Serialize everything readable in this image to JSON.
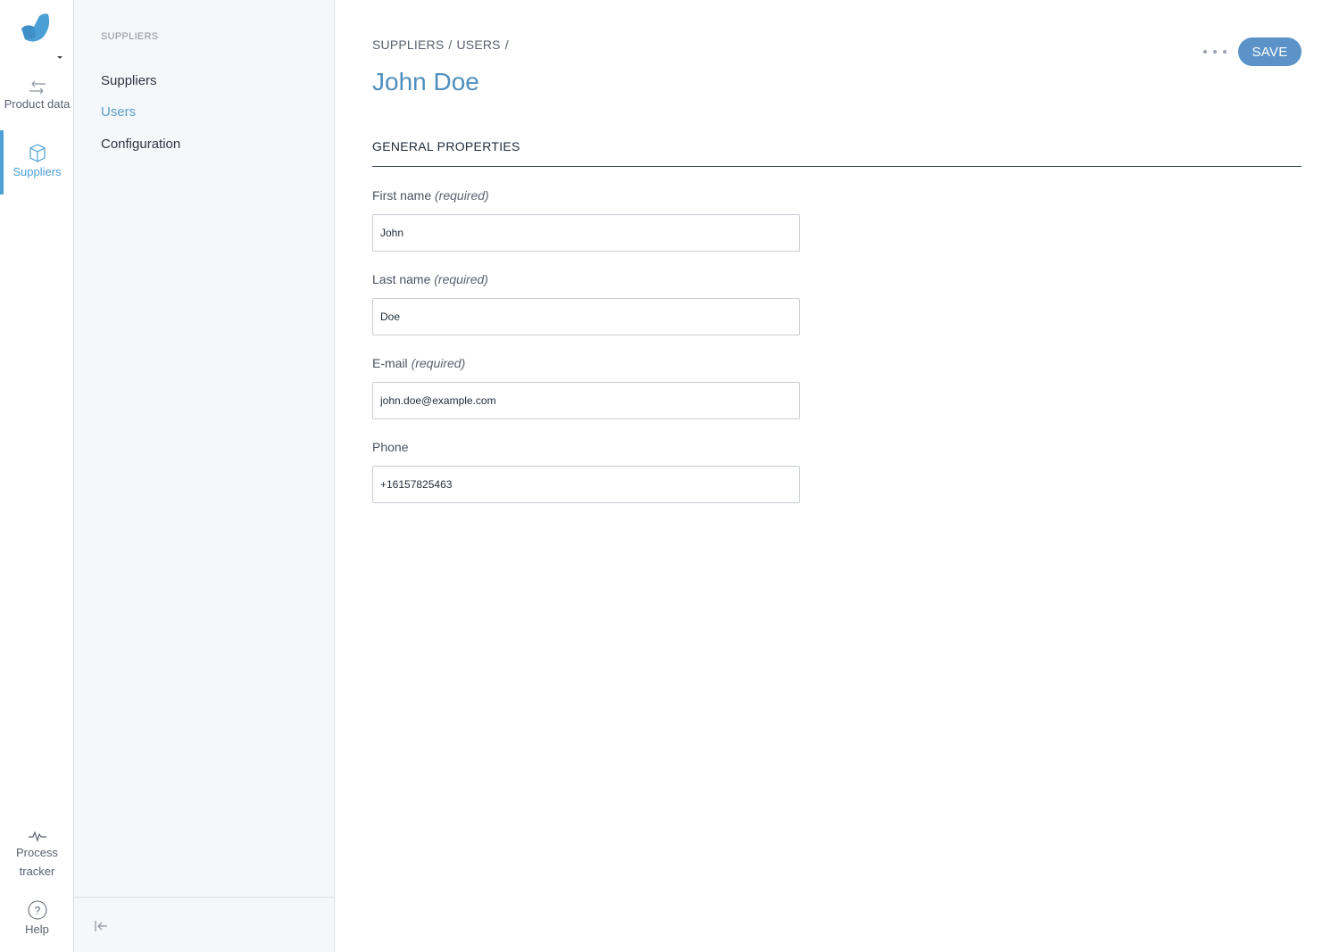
{
  "rail": {
    "items": [
      {
        "label": "Product data",
        "icon": "arrows-exchange-icon"
      },
      {
        "label": "Suppliers",
        "icon": "box-icon"
      },
      {
        "label": "Process tracker",
        "icon": "pulse-icon"
      },
      {
        "label": "Help",
        "icon": "question-circle-icon"
      }
    ]
  },
  "subnav": {
    "section_label": "SUPPLIERS",
    "items": [
      {
        "label": "Suppliers"
      },
      {
        "label": "Users"
      },
      {
        "label": "Configuration"
      }
    ]
  },
  "header": {
    "breadcrumb": [
      "SUPPLIERS",
      "USERS"
    ],
    "breadcrumb_sep": "/",
    "title": "John Doe",
    "save_label": "SAVE"
  },
  "form": {
    "section_title": "GENERAL PROPERTIES",
    "required_text": "(required)",
    "fields": [
      {
        "label": "First name",
        "value": "John"
      },
      {
        "label": "Last name",
        "value": "Doe"
      },
      {
        "label": "E-mail",
        "value": "john.doe@example.com"
      },
      {
        "label": "Phone",
        "value": "+16157825463"
      }
    ]
  },
  "colors": {
    "accent": "#4a9fd4",
    "title": "#4f8fbf",
    "save_button": "#5b93c9",
    "subnav_bg": "#f5f8fb"
  }
}
